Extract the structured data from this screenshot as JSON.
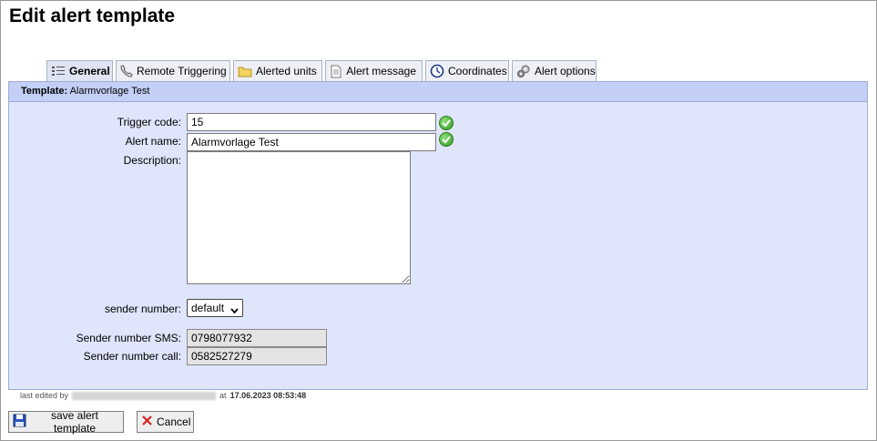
{
  "page": {
    "title": "Edit alert template"
  },
  "tabs": [
    {
      "label": "General",
      "icon": "list-icon",
      "active": true
    },
    {
      "label": "Remote Triggering",
      "icon": "phone-icon"
    },
    {
      "label": "Alerted units",
      "icon": "folder-icon"
    },
    {
      "label": "Alert message",
      "icon": "document-icon"
    },
    {
      "label": "Coordinates",
      "icon": "compass-icon"
    },
    {
      "label": "Alert options",
      "icon": "gears-icon"
    }
  ],
  "panel": {
    "header_label": "Template:",
    "header_value": "Alarmvorlage Test"
  },
  "form": {
    "trigger_code_label": "Trigger code:",
    "trigger_code_value": "15",
    "alert_name_label": "Alert name:",
    "alert_name_value": "Alarmvorlage Test",
    "description_label": "Description:",
    "description_value": "",
    "sender_number_label": "sender number:",
    "sender_number_value": "default",
    "sender_sms_label": "Sender number SMS:",
    "sender_sms_value": "0798077932",
    "sender_call_label": "Sender number call:",
    "sender_call_value": "0582527279"
  },
  "footer": {
    "last_edited_prefix": "last edited by",
    "last_edited_at": "at",
    "last_edited_timestamp": "17.06.2023 08:53:48"
  },
  "buttons": {
    "save_label": "save alert template",
    "cancel_label": "Cancel"
  },
  "colors": {
    "panel_bg": "#dfe5fb",
    "panel_header_bg": "#c3cff6",
    "valid_icon": "#2f9a1e",
    "cancel_icon": "#d42020"
  }
}
